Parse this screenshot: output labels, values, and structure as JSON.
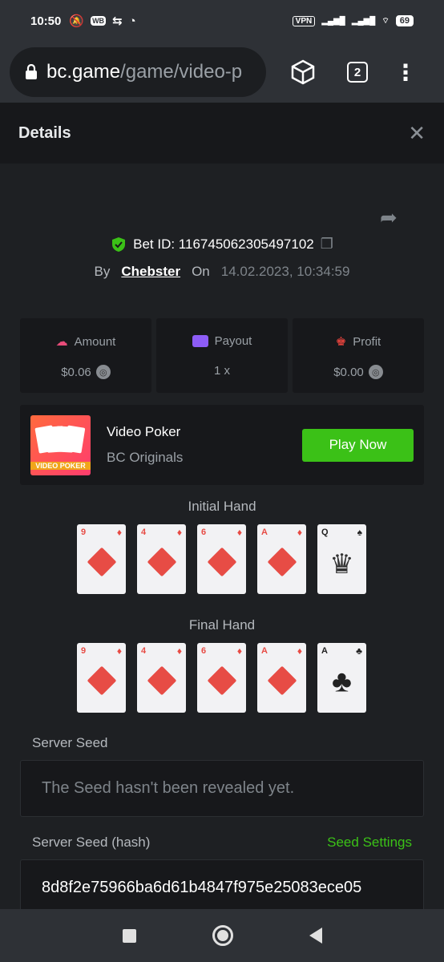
{
  "status": {
    "time": "10:50",
    "vpn": "VPN",
    "battery": "69",
    "wb": "WB"
  },
  "browser": {
    "host": "bc.game",
    "path": "/game/video-p",
    "tab_count": "2"
  },
  "panel": {
    "title": "Details",
    "close": "✕"
  },
  "bet": {
    "id_label": "Bet ID: 116745062305497102",
    "by": "By",
    "user": "Chebster",
    "on": "On",
    "date": "14.02.2023, 10:34:59"
  },
  "stats": [
    {
      "label": "Amount",
      "value": "$0.06"
    },
    {
      "label": "Payout",
      "value": "1 x"
    },
    {
      "label": "Profit",
      "value": "$0.00"
    }
  ],
  "game": {
    "name": "Video Poker",
    "provider": "BC Originals",
    "thumb_text": "VIDEO POKER",
    "play": "Play Now"
  },
  "initial_hand": {
    "title": "Initial Hand",
    "cards": [
      {
        "rank": "9",
        "suit": "♦"
      },
      {
        "rank": "4",
        "suit": "♦"
      },
      {
        "rank": "6",
        "suit": "♦"
      },
      {
        "rank": "A",
        "suit": "♦"
      },
      {
        "rank": "Q",
        "suit": "♠"
      }
    ]
  },
  "final_hand": {
    "title": "Final Hand",
    "cards": [
      {
        "rank": "9",
        "suit": "♦"
      },
      {
        "rank": "4",
        "suit": "♦"
      },
      {
        "rank": "6",
        "suit": "♦"
      },
      {
        "rank": "A",
        "suit": "♦"
      },
      {
        "rank": "A",
        "suit": "♣"
      }
    ]
  },
  "server_seed": {
    "label": "Server Seed",
    "value": "The Seed hasn't been revealed yet."
  },
  "server_seed_hash": {
    "label": "Server Seed (hash)",
    "link": "Seed Settings",
    "value": "8d8f2e75966ba6d61b4847f975e25083ece05"
  },
  "colors": {
    "accent_green": "#3bc117",
    "card_red": "#e74c45"
  }
}
